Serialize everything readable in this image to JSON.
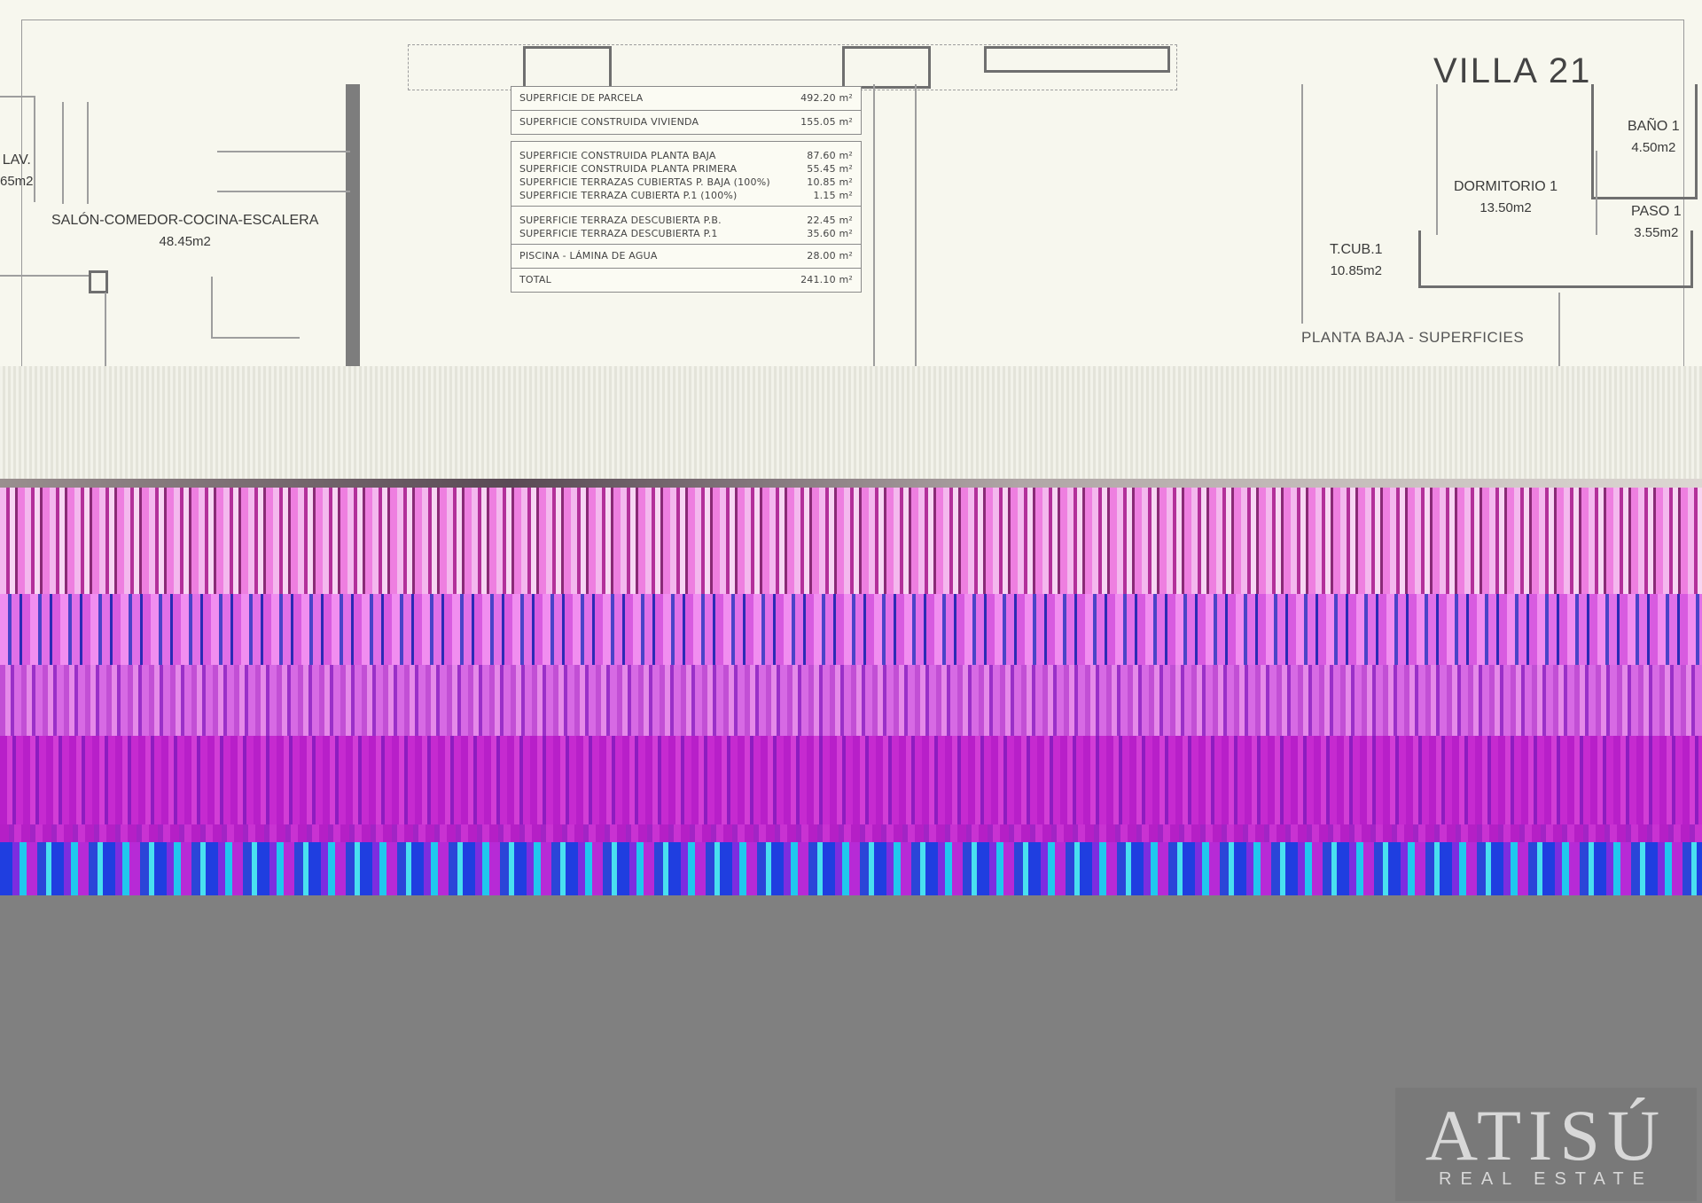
{
  "plan": {
    "villa_title": "VILLA 21",
    "section_title": "PLANTA BAJA - SUPERFICIES",
    "rooms": [
      {
        "name": "LAV.",
        "area": "65m2"
      },
      {
        "name": "SALÓN-COMEDOR-COCINA-ESCALERA",
        "area": "48.45m2"
      },
      {
        "name": "DORMITORIO 1",
        "area": "13.50m2"
      },
      {
        "name": "BAÑO 1",
        "area": "4.50m2"
      },
      {
        "name": "PASO 1",
        "area": "3.55m2"
      },
      {
        "name": "T.CUB.1",
        "area": "10.85m2"
      }
    ],
    "surfaces_table": {
      "parcela": {
        "label": "SUPERFICIE DE PARCELA",
        "value": "492.20 m²"
      },
      "vivienda": {
        "label": "SUPERFICIE CONSTRUIDA VIVIENDA",
        "value": "155.05 m²"
      },
      "group1": [
        {
          "label": "SUPERFICIE CONSTRUIDA PLANTA BAJA",
          "value": "87.60 m²"
        },
        {
          "label": "SUPERFICIE CONSTRUIDA PLANTA PRIMERA",
          "value": "55.45 m²"
        },
        {
          "label": "SUPERFICIE TERRAZAS CUBIERTAS P. BAJA (100%)",
          "value": "10.85 m²"
        },
        {
          "label": "SUPERFICIE TERRAZA CUBIERTA P.1 (100%)",
          "value": "1.15 m²"
        }
      ],
      "group2": [
        {
          "label": "SUPERFICIE TERRAZA DESCUBIERTA P.B.",
          "value": "22.45 m²"
        },
        {
          "label": "SUPERFICIE TERRAZA DESCUBIERTA P.1",
          "value": "35.60 m²"
        }
      ],
      "piscina": {
        "label": "PISCINA - LÁMINA DE AGUA",
        "value": "28.00 m²"
      },
      "total": {
        "label": "TOTAL",
        "value": "241.10 m²"
      }
    }
  },
  "watermark": {
    "logo": "ATISÚ",
    "tagline": "REAL ESTATE"
  },
  "colors": {
    "plan_bg": "#f7f7ee",
    "glitch_magenta": "#c020c8",
    "glitch_blue": "#3030d0",
    "bottom_gray": "#808080"
  }
}
